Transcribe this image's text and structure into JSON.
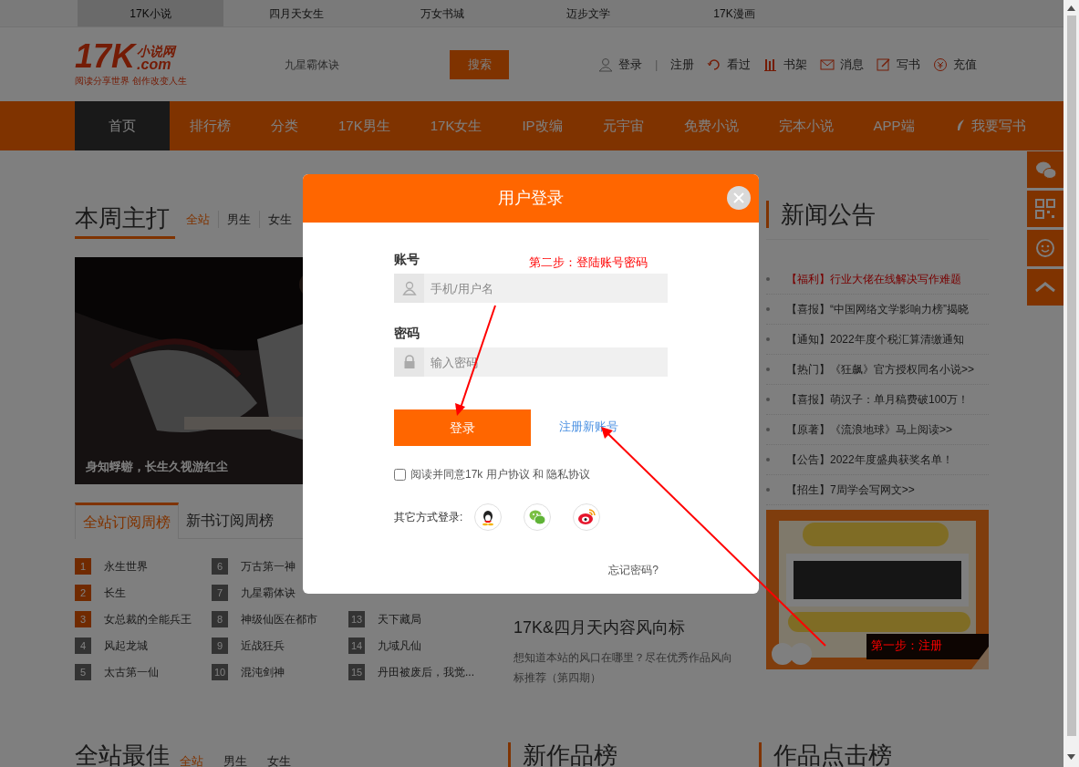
{
  "top_links": [
    {
      "label": "17K小说",
      "selected": true
    },
    {
      "label": "四月天女生",
      "selected": false
    },
    {
      "label": "万女书城",
      "selected": false
    },
    {
      "label": "迈步文学",
      "selected": false
    },
    {
      "label": "17K漫画",
      "selected": false
    }
  ],
  "header": {
    "logo": {
      "mark": "17K",
      "name": "小说网",
      "domain": ".com",
      "slogan": "阅读分享世界 创作改变人生"
    },
    "search": {
      "placeholder": "九星霸体诀",
      "button": "搜索"
    },
    "user_links": [
      {
        "kind": "login",
        "label": "登录"
      },
      {
        "kind": "register",
        "label": "注册"
      },
      {
        "kind": "history",
        "label": "看过"
      },
      {
        "kind": "shelf",
        "label": "书架"
      },
      {
        "kind": "message",
        "label": "消息"
      },
      {
        "kind": "write",
        "label": "写书"
      },
      {
        "kind": "recharge",
        "label": "充值"
      }
    ],
    "separator": "|"
  },
  "nav": [
    {
      "label": "首页",
      "selected": true,
      "kind": "link"
    },
    {
      "label": "排行榜",
      "selected": false,
      "kind": "link"
    },
    {
      "label": "分类",
      "selected": false,
      "kind": "link"
    },
    {
      "label": "17K男生",
      "selected": false,
      "kind": "link"
    },
    {
      "label": "17K女生",
      "selected": false,
      "kind": "link"
    },
    {
      "label": "IP改编",
      "selected": false,
      "kind": "link"
    },
    {
      "label": "元宇宙",
      "selected": false,
      "kind": "link"
    },
    {
      "label": "免费小说",
      "selected": false,
      "kind": "link"
    },
    {
      "label": "完本小说",
      "selected": false,
      "kind": "link"
    },
    {
      "label": "APP端",
      "selected": false,
      "kind": "link"
    },
    {
      "label": "我要写书",
      "selected": false,
      "kind": "write"
    }
  ],
  "weekly": {
    "title": "本周主打",
    "tabs": [
      {
        "label": "全站",
        "selected": true
      },
      {
        "label": "男生",
        "selected": false
      },
      {
        "label": "女生",
        "selected": false
      }
    ],
    "banner": {
      "kind": "picture",
      "caption": "身知蜉蝣，长生久视游红尘"
    }
  },
  "rank_tabs": [
    {
      "label": "全站订阅周榜",
      "selected": true
    },
    {
      "label": "新书订阅周榜",
      "selected": false
    }
  ],
  "rank_columns": [
    [
      {
        "rank": "1",
        "title": "永生世界",
        "highlighted": true
      },
      {
        "rank": "2",
        "title": "长生",
        "highlighted": true
      },
      {
        "rank": "3",
        "title": "女总裁的全能兵王",
        "highlighted": true
      },
      {
        "rank": "4",
        "title": "风起龙城",
        "highlighted": false
      },
      {
        "rank": "5",
        "title": "太古第一仙",
        "highlighted": false
      }
    ],
    [
      {
        "rank": "6",
        "title": "万古第一神",
        "highlighted": false
      },
      {
        "rank": "7",
        "title": "九星霸体诀",
        "highlighted": false
      },
      {
        "rank": "8",
        "title": "神级仙医在都市",
        "highlighted": false
      },
      {
        "rank": "9",
        "title": "近战狂兵",
        "highlighted": false
      },
      {
        "rank": "10",
        "title": "混沌剑神",
        "highlighted": false
      }
    ],
    [
      {
        "rank": "13",
        "title": "天下藏局",
        "highlighted": false
      },
      {
        "rank": "14",
        "title": "九域凡仙",
        "highlighted": false
      },
      {
        "rank": "15",
        "title": "丹田被废后，我觉...",
        "highlighted": false
      }
    ]
  ],
  "feature": {
    "title": "17K&四月天内容风向标",
    "description": "想知道本站的风口在哪里？尽在优秀作品风向标推荐（第四期）"
  },
  "news": {
    "title": "新闻公告",
    "items": [
      {
        "text": "【福利】行业大佬在线解决写作难题",
        "highlighted": true
      },
      {
        "text": "【喜报】“中国网络文学影响力榜”揭晓",
        "highlighted": false
      },
      {
        "text": "【通知】2022年度个税汇算清缴通知",
        "highlighted": false
      },
      {
        "text": "【热门】《狂飙》官方授权同名小说>>",
        "highlighted": false
      },
      {
        "text": "【喜报】萌汉子：单月稿费破100万！",
        "highlighted": false
      },
      {
        "text": "【原著】《流浪地球》马上阅读>>",
        "highlighted": false
      },
      {
        "text": "【公告】2022年度盛典获奖名单！",
        "highlighted": false
      },
      {
        "text": "【招生】7周学会写网文>>",
        "highlighted": false
      }
    ]
  },
  "promo": {
    "kind": "picture"
  },
  "side_tools": [
    {
      "kind": "wechat"
    },
    {
      "kind": "qrcode"
    },
    {
      "kind": "service"
    },
    {
      "kind": "top"
    }
  ],
  "bottom_sections": {
    "best_title": "全站最佳",
    "best_tabs": [
      {
        "label": "全站",
        "selected": true
      },
      {
        "label": "男生",
        "selected": false
      },
      {
        "label": "女生",
        "selected": false
      }
    ],
    "new_title": "新作品榜",
    "click_title": "作品点击榜"
  },
  "login_dialog": {
    "title": "用户登录",
    "account_label": "账号",
    "account_placeholder": "手机/用户名",
    "password_label": "密码",
    "password_placeholder": "输入密码",
    "login_button": "登录",
    "register_link": "注册新账号",
    "agree": {
      "checked": false,
      "text": "阅读并同意17k 用户协议 和 隐私协议"
    },
    "other_login": {
      "label": "其它方式登录:",
      "providers": [
        {
          "kind": "qq"
        },
        {
          "kind": "wechat"
        },
        {
          "kind": "weibo"
        }
      ]
    },
    "forgot": "忘记密码?"
  },
  "annotations": [
    {
      "text": "第二步：登陆账号密码"
    },
    {
      "text": "第一步：注册"
    }
  ]
}
